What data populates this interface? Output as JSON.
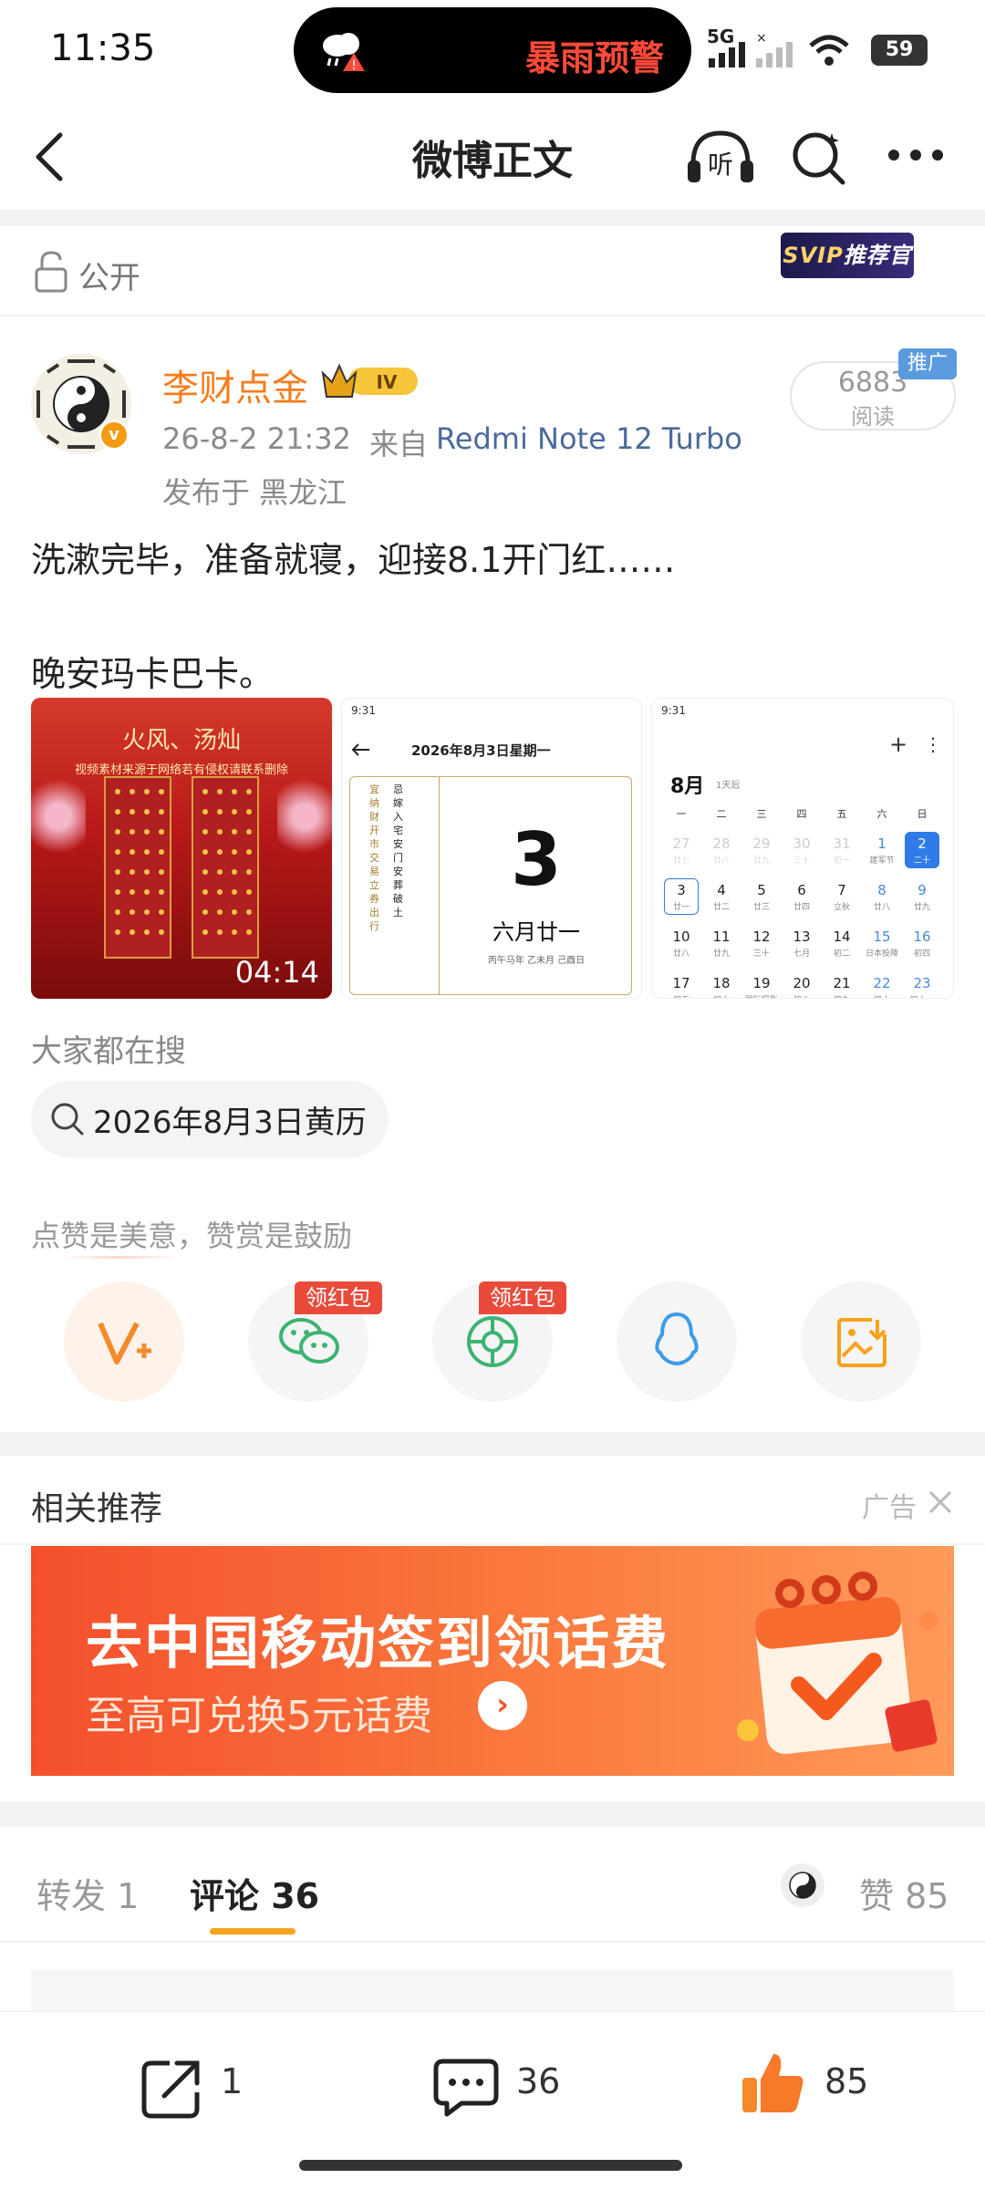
{
  "status_bar": {
    "time": "11:35",
    "alert": "暴雨预警",
    "network": "5G",
    "battery": "59"
  },
  "nav": {
    "title": "微博正文",
    "listen": "听"
  },
  "post": {
    "visibility": "公开",
    "svip_badge_v": "SVIP",
    "svip_badge_text": "推荐官",
    "author": {
      "name": "李财点金",
      "level": "IV",
      "verified_mark": "v"
    },
    "timestamp": "26-8-2 21:32",
    "from_label": "来自",
    "device": "Redmi Note 12 Turbo",
    "location": "发布于 黑龙江",
    "reads": {
      "count": "6883",
      "label": "阅读",
      "promo": "推广"
    },
    "text_lines": [
      "洗漱完毕，准备就寝，迎接8.1开门红……",
      "晚安玛卡巴卡。"
    ],
    "images": {
      "video": {
        "title": "火风、汤灿",
        "caption": "视频素材来源于网络若有侵权请联系删除",
        "duration": "04:14"
      },
      "almanac": {
        "time": "9:31",
        "date_title": "2026年8月3日星期一",
        "big_day": "3",
        "lunar": "六月廿一",
        "ganzhi": "丙午马年 乙未月 己酉日",
        "col_left": [
          "宜",
          "纳",
          "财",
          "开",
          "市",
          "交",
          "易",
          "立",
          "券",
          "出",
          "行"
        ],
        "col_right": [
          "忌",
          "嫁",
          "入",
          "宅",
          "安",
          "门",
          "安",
          "葬",
          "破",
          "土"
        ]
      },
      "calendar": {
        "time": "9:31",
        "month": "8月",
        "month_sub": "1天后",
        "weekdays": [
          "一",
          "二",
          "三",
          "四",
          "五",
          "六",
          "日"
        ],
        "rows": [
          [
            [
              "27",
              "廿七"
            ],
            [
              "28",
              "廿八"
            ],
            [
              "29",
              "廿九"
            ],
            [
              "30",
              "三十"
            ],
            [
              "31",
              "初一"
            ],
            [
              "1",
              "建军节"
            ],
            [
              "2",
              "二十"
            ]
          ],
          [
            [
              "3",
              "廿一"
            ],
            [
              "4",
              "廿二"
            ],
            [
              "5",
              "廿三"
            ],
            [
              "6",
              "廿四"
            ],
            [
              "7",
              "立秋"
            ],
            [
              "8",
              "廿八"
            ],
            [
              "9",
              "廿九"
            ]
          ],
          [
            [
              "10",
              "廿八"
            ],
            [
              "11",
              "廿九"
            ],
            [
              "12",
              "三十"
            ],
            [
              "13",
              "七月"
            ],
            [
              "14",
              "初二"
            ],
            [
              "15",
              "日本投降"
            ],
            [
              "16",
              "初四"
            ]
          ],
          [
            [
              "17",
              "初五"
            ],
            [
              "18",
              "初六"
            ],
            [
              "19",
              "国际摄影"
            ],
            [
              "20",
              "初八"
            ],
            [
              "21",
              "初九"
            ],
            [
              "22",
              "初十"
            ],
            [
              "23",
              "初十一"
            ]
          ]
        ]
      }
    }
  },
  "search": {
    "heading": "大家都在搜",
    "query": "2026年8月3日黄历"
  },
  "like_hint": "点赞是美意，赞赏是鼓励",
  "share_tags": [
    "领红包",
    "领红包"
  ],
  "related": {
    "heading": "相关推荐",
    "ad_label": "广告",
    "banner_title": "去中国移动签到领话费",
    "banner_subtitle": "至高可兑换5元话费"
  },
  "tabs": {
    "repost": "转发 1",
    "comment": "评论 36",
    "like": "赞 85"
  },
  "bottom_bar": {
    "repost_count": "1",
    "comment_count": "36",
    "like_count": "85"
  },
  "colors": {
    "accent_orange": "#f77c1b",
    "link_blue": "#4a6a9a",
    "alert_red": "#ff4a3a",
    "tab_underline": "#f7a21b"
  }
}
